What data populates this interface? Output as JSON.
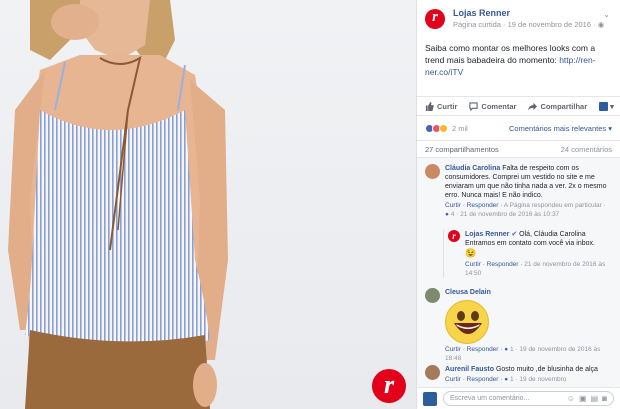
{
  "post": {
    "page_name": "Lojas Renner",
    "meta": "Página curtida · 19 de novembro de 2016 · ",
    "text": "Saiba como montar os melhores looks com a trend mais babadeira do momento: ",
    "link": "http://ren-ner.co/iTV"
  },
  "actions": {
    "like": "Curtir",
    "comment": "Comentar",
    "share": "Compartilhar"
  },
  "reactions": {
    "count": "2 mil",
    "sort": "Comentários mais relevantes ▾"
  },
  "stats": {
    "shares": "27 compartilhamentos",
    "comments": "24 comentários"
  },
  "comments": [
    {
      "author": "Cláudia Carolina",
      "text": "Falta de respeito com os consumidores. Comprei um vestido no site e me enviaram um que não tinha nada a ver. 2x o mesmo erro. Nunca mais! E não indico.",
      "foot_actions": "Curtir · Responder ·",
      "foot_note": "A Página respondeu em particular",
      "likes": "4",
      "date": "21 de novembro de 2016 às 10:37"
    },
    {
      "author": "Lojas Renner",
      "text": "Olá, Cláudia Carolina Entramos em contato com você via inbox.",
      "emoji": "😉",
      "foot_actions": "Curtir · Responder ·",
      "date": "21 de novembro de 2016 às 14:50"
    },
    {
      "author": "Cleusa Delain",
      "foot_actions": "Curtir · Responder ·",
      "likes": "1",
      "date": "19 de novembro de 2016 às 18:48"
    },
    {
      "author": "Aurenil Fausto",
      "text": "Gosto muito ,de blusinha de alça",
      "foot_actions": "Curtir · Responder ·",
      "likes": "1",
      "date": "19 de novembro"
    }
  ],
  "composer": {
    "placeholder": "Escreva um comentário..."
  },
  "photo": {
    "logo_letter": "r"
  },
  "colors": {
    "brand_red": "#e3001b",
    "fb_blue": "#365899"
  }
}
